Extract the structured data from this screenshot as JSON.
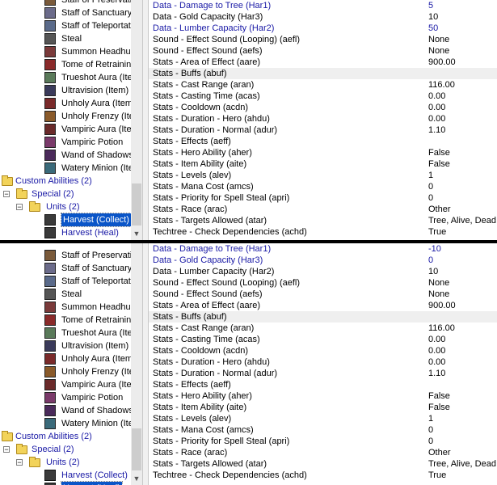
{
  "tree": {
    "items": [
      {
        "label": "Staff of Preservation",
        "color": "#7a5a3a"
      },
      {
        "label": "Staff of Sanctuary",
        "color": "#6b6b8a"
      },
      {
        "label": "Staff of Teleportation",
        "color": "#5a6a8a"
      },
      {
        "label": "Steal",
        "color": "#555"
      },
      {
        "label": "Summon Headhunter",
        "color": "#7a3a3a"
      },
      {
        "label": "Tome of Retraining",
        "color": "#8a2a2a"
      },
      {
        "label": "Trueshot Aura (Item)",
        "color": "#5a7a5a"
      },
      {
        "label": "Ultravision (Item)",
        "color": "#3a3a5a"
      },
      {
        "label": "Unholy Aura (Item)",
        "color": "#7a2a2a"
      },
      {
        "label": "Unholy Frenzy (Item)",
        "color": "#8a5a2a"
      },
      {
        "label": "Vampiric Aura (Item)",
        "color": "#6a2a2a"
      },
      {
        "label": "Vampiric Potion",
        "color": "#7a3a6a"
      },
      {
        "label": "Wand of Shadowsight",
        "color": "#4a2a5a"
      },
      {
        "label": "Watery Minion (Item)",
        "color": "#3a6a7a"
      }
    ],
    "custom_abilities": "Custom Abilities (2)",
    "special": "Special (2)",
    "units": "Units (2)",
    "harvest_collect": "Harvest (Collect)",
    "harvest_heal": "Harvest (Heal)"
  },
  "top": {
    "rows": [
      {
        "k": "Data - Damage to Tree (Har1)",
        "v": "5",
        "blue": true
      },
      {
        "k": "Data - Gold Capacity (Har3)",
        "v": "10",
        "blue": false
      },
      {
        "k": "Data - Lumber Capacity (Har2)",
        "v": "50",
        "blue": true
      },
      {
        "k": "Sound - Effect Sound (Looping) (aefl)",
        "v": "None"
      },
      {
        "k": "Sound - Effect Sound (aefs)",
        "v": "None"
      },
      {
        "k": "Stats - Area of Effect (aare)",
        "v": "900.00"
      },
      {
        "k": "Stats - Buffs (abuf)",
        "v": "",
        "hdr": true
      },
      {
        "k": "Stats - Cast Range (aran)",
        "v": "116.00"
      },
      {
        "k": "Stats - Casting Time (acas)",
        "v": "0.00"
      },
      {
        "k": "Stats - Cooldown (acdn)",
        "v": "0.00"
      },
      {
        "k": "Stats - Duration - Hero (ahdu)",
        "v": "0.00"
      },
      {
        "k": "Stats - Duration - Normal (adur)",
        "v": "1.10"
      },
      {
        "k": "Stats - Effects (aeff)",
        "v": ""
      },
      {
        "k": "Stats - Hero Ability (aher)",
        "v": "False"
      },
      {
        "k": "Stats - Item Ability (aite)",
        "v": "False"
      },
      {
        "k": "Stats - Levels (alev)",
        "v": "1"
      },
      {
        "k": "Stats - Mana Cost (amcs)",
        "v": "0"
      },
      {
        "k": "Stats - Priority for Spell Steal (apri)",
        "v": "0"
      },
      {
        "k": "Stats - Race (arac)",
        "v": "Other"
      },
      {
        "k": "Stats - Targets Allowed (atar)",
        "v": "Tree, Alive, Dead"
      },
      {
        "k": "Techtree - Check Dependencies (achd)",
        "v": "True"
      }
    ]
  },
  "bottom": {
    "rows": [
      {
        "k": "Data - Damage to Tree (Har1)",
        "v": "-10",
        "blue": true
      },
      {
        "k": "Data - Gold Capacity (Har3)",
        "v": "0",
        "blue": true
      },
      {
        "k": "Data - Lumber Capacity (Har2)",
        "v": "10",
        "blue": false
      },
      {
        "k": "Sound - Effect Sound (Looping) (aefl)",
        "v": "None"
      },
      {
        "k": "Sound - Effect Sound (aefs)",
        "v": "None"
      },
      {
        "k": "Stats - Area of Effect (aare)",
        "v": "900.00"
      },
      {
        "k": "Stats - Buffs (abuf)",
        "v": "",
        "hdr": true
      },
      {
        "k": "Stats - Cast Range (aran)",
        "v": "116.00"
      },
      {
        "k": "Stats - Casting Time (acas)",
        "v": "0.00"
      },
      {
        "k": "Stats - Cooldown (acdn)",
        "v": "0.00"
      },
      {
        "k": "Stats - Duration - Hero (ahdu)",
        "v": "0.00"
      },
      {
        "k": "Stats - Duration - Normal (adur)",
        "v": "1.10"
      },
      {
        "k": "Stats - Effects (aeff)",
        "v": ""
      },
      {
        "k": "Stats - Hero Ability (aher)",
        "v": "False"
      },
      {
        "k": "Stats - Item Ability (aite)",
        "v": "False"
      },
      {
        "k": "Stats - Levels (alev)",
        "v": "1"
      },
      {
        "k": "Stats - Mana Cost (amcs)",
        "v": "0"
      },
      {
        "k": "Stats - Priority for Spell Steal (apri)",
        "v": "0"
      },
      {
        "k": "Stats - Race (arac)",
        "v": "Other"
      },
      {
        "k": "Stats - Targets Allowed (atar)",
        "v": "Tree, Alive, Dead"
      },
      {
        "k": "Techtree - Check Dependencies (achd)",
        "v": "True"
      }
    ]
  },
  "colors": {
    "link_blue": "#1a1aa6",
    "selection": "#0a55c8"
  }
}
